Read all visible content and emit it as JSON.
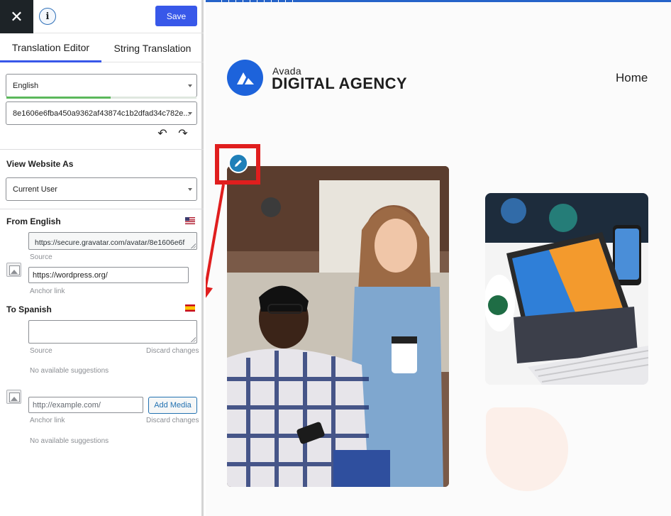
{
  "toolbar": {
    "close_glyph": "✕",
    "info_glyph": "i",
    "save_label": "Save"
  },
  "tabs": [
    {
      "label": "Translation Editor",
      "active": true
    },
    {
      "label": "String Translation",
      "active": false
    }
  ],
  "language_select": {
    "value": "English",
    "progress": 0.55
  },
  "string_select": {
    "value": "8e1606e6fba450a9362af43874c1b2dfad34c782e..."
  },
  "history": {
    "undo_glyph": "↶",
    "redo_glyph": "↷"
  },
  "view_as": {
    "title": "View Website As",
    "value": "Current User"
  },
  "from": {
    "title": "From English",
    "flag": "us-flag",
    "source_value": "https://secure.gravatar.com/avatar/8e1606e6f",
    "source_label": "Source",
    "anchor_value": "https://wordpress.org/",
    "anchor_label": "Anchor link"
  },
  "to": {
    "title": "To Spanish",
    "flag": "spain-flag",
    "source_value": "",
    "source_label": "Source",
    "discard_label_1": "Discard changes",
    "no_suggestions_1": "No available suggestions",
    "anchor_placeholder": "http://example.com/",
    "add_media_label": "Add Media",
    "anchor_label": "Anchor link",
    "discard_label_2": "Discard changes",
    "no_suggestions_2": "No available suggestions"
  },
  "preview": {
    "logo_small": "Avada",
    "logo_big": "DIGITAL AGENCY",
    "nav_home": "Home",
    "accent_color": "#1d63db",
    "highlight_color": "#e01e1e"
  },
  "colors": {
    "primary": "#3858e9",
    "close_bg": "#1d2327",
    "progress": "#5cb85c"
  }
}
